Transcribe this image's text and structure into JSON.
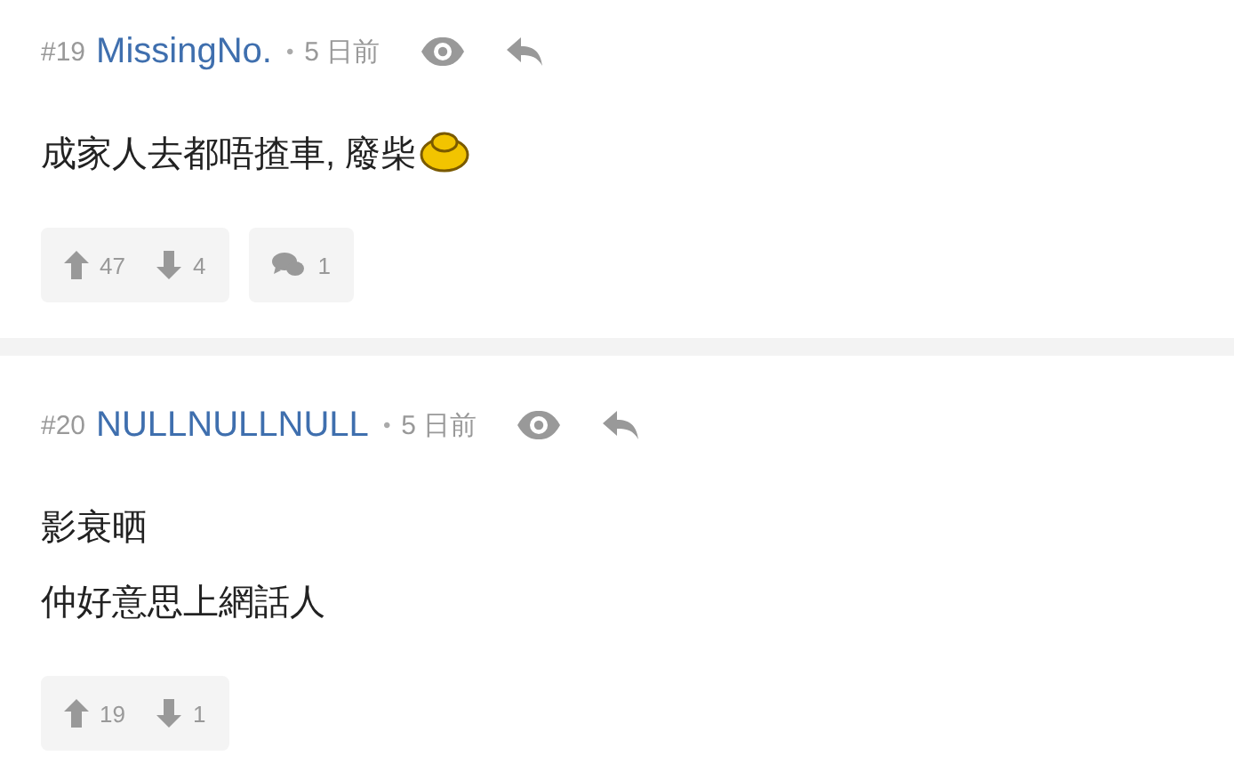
{
  "posts": [
    {
      "number": "#19",
      "author": "MissingNo.",
      "dot": "•",
      "time": "5 日前",
      "lines": [
        "成家人去都唔揸車, 廢柴"
      ],
      "emoji": true,
      "upvotes": "47",
      "downvotes": "4",
      "replies": "1"
    },
    {
      "number": "#20",
      "author": "NULLNULLNULL",
      "dot": "•",
      "time": "5 日前",
      "lines": [
        "影衰晒",
        "仲好意思上網話人"
      ],
      "emoji": false,
      "upvotes": "19",
      "downvotes": "1"
    }
  ]
}
